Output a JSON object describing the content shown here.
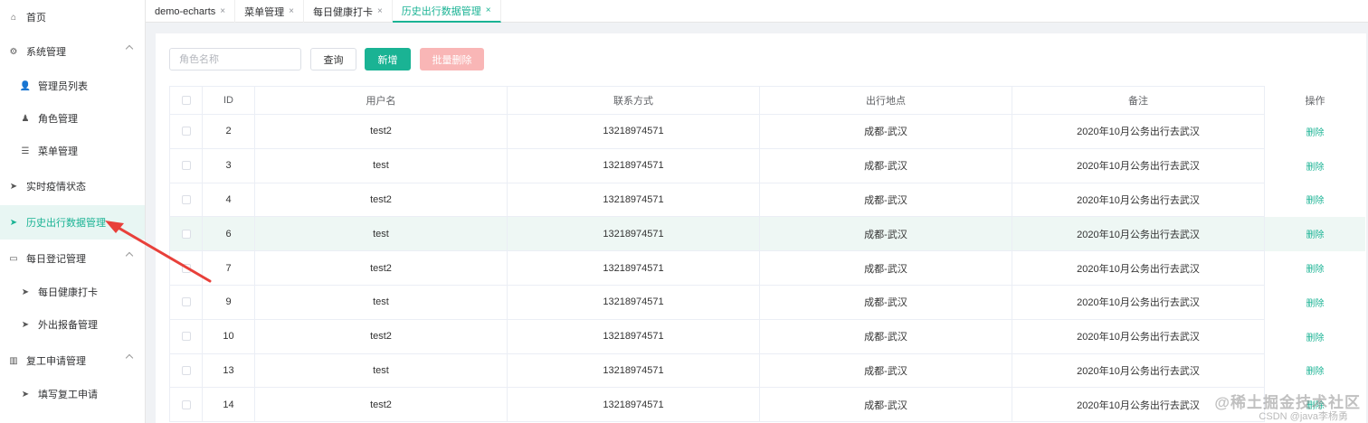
{
  "sidebar": {
    "items": [
      {
        "label": "首页",
        "icon": "home-icon",
        "glyph": "⌂"
      },
      {
        "label": "系统管理",
        "icon": "gear-icon",
        "glyph": "⚙"
      },
      {
        "label": "管理员列表",
        "icon": "user-icon",
        "glyph": "👤"
      },
      {
        "label": "角色管理",
        "icon": "role-icon",
        "glyph": "♟"
      },
      {
        "label": "菜单管理",
        "icon": "list-icon",
        "glyph": "☰"
      },
      {
        "label": "实时疫情状态",
        "icon": "send-icon",
        "glyph": "➤"
      },
      {
        "label": "历史出行数据管理",
        "icon": "send-icon",
        "glyph": "➤"
      },
      {
        "label": "每日登记管理",
        "icon": "chat-icon",
        "glyph": "▭"
      },
      {
        "label": "每日健康打卡",
        "icon": "send-icon",
        "glyph": "➤"
      },
      {
        "label": "外出报备管理",
        "icon": "send-icon",
        "glyph": "➤"
      },
      {
        "label": "复工申请管理",
        "icon": "bar-chart-icon",
        "glyph": "▥"
      },
      {
        "label": "填写复工申请",
        "icon": "send-icon",
        "glyph": "➤"
      }
    ],
    "active_label": "历史出行数据管理"
  },
  "tabs": [
    {
      "label": "demo-echarts"
    },
    {
      "label": "菜单管理"
    },
    {
      "label": "每日健康打卡"
    },
    {
      "label": "历史出行数据管理"
    }
  ],
  "tab_close_glyph": "×",
  "toolbar": {
    "search_placeholder": "角色名称",
    "query_label": "查询",
    "add_label": "新增",
    "batch_delete_label": "批量删除"
  },
  "table": {
    "headers": [
      "ID",
      "用户名",
      "联系方式",
      "出行地点",
      "备注",
      "操作"
    ],
    "rows": [
      {
        "id": "2",
        "username": "test2",
        "contact": "13218974571",
        "place": "成都-武汉",
        "remark": "2020年10月公务出行去武汉",
        "action": "删除"
      },
      {
        "id": "3",
        "username": "test",
        "contact": "13218974571",
        "place": "成都-武汉",
        "remark": "2020年10月公务出行去武汉",
        "action": "删除"
      },
      {
        "id": "4",
        "username": "test2",
        "contact": "13218974571",
        "place": "成都-武汉",
        "remark": "2020年10月公务出行去武汉",
        "action": "删除"
      },
      {
        "id": "6",
        "username": "test",
        "contact": "13218974571",
        "place": "成都-武汉",
        "remark": "2020年10月公务出行去武汉",
        "action": "删除"
      },
      {
        "id": "7",
        "username": "test2",
        "contact": "13218974571",
        "place": "成都-武汉",
        "remark": "2020年10月公务出行去武汉",
        "action": "删除"
      },
      {
        "id": "9",
        "username": "test",
        "contact": "13218974571",
        "place": "成都-武汉",
        "remark": "2020年10月公务出行去武汉",
        "action": "删除"
      },
      {
        "id": "10",
        "username": "test2",
        "contact": "13218974571",
        "place": "成都-武汉",
        "remark": "2020年10月公务出行去武汉",
        "action": "删除"
      },
      {
        "id": "13",
        "username": "test",
        "contact": "13218974571",
        "place": "成都-武汉",
        "remark": "2020年10月公务出行去武汉",
        "action": "删除"
      },
      {
        "id": "14",
        "username": "test2",
        "contact": "13218974571",
        "place": "成都-武汉",
        "remark": "2020年10月公务出行去武汉",
        "action": "删除"
      }
    ],
    "highlighted_row_id": "6"
  },
  "watermark": {
    "line1": "@稀土掘金技术社区",
    "line2": "CSDN @java李杨勇"
  },
  "colors": {
    "accent": "#1ab394",
    "danger_light": "#f9b6b6",
    "annotation_arrow": "#e8403a"
  }
}
